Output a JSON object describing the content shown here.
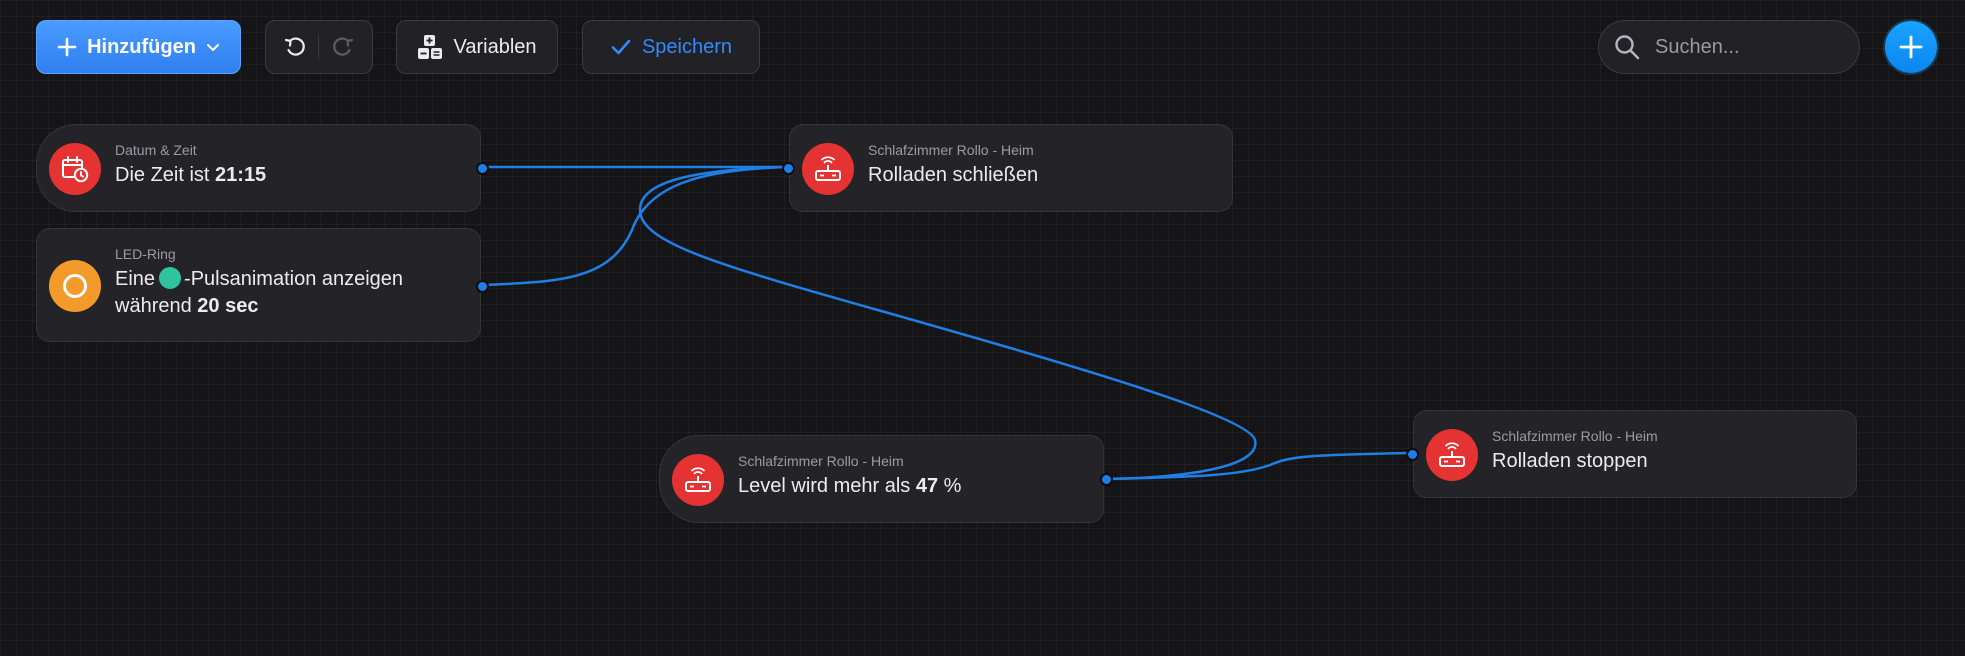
{
  "toolbar": {
    "add_label": "Hinzufügen",
    "variables_label": "Variablen",
    "save_label": "Speichern"
  },
  "search": {
    "placeholder": "Suchen..."
  },
  "nodes": {
    "datetime": {
      "subtitle": "Datum & Zeit",
      "text_prefix": "Die Zeit ist",
      "time_value": "21:15"
    },
    "ledring": {
      "subtitle": "LED-Ring",
      "text_prefix": "Eine",
      "text_suffix": "-Pulsanimation anzeigen",
      "line2_prefix": "während",
      "duration_value": "20 sec",
      "swatch_color": "#2ec4a0"
    },
    "close": {
      "subtitle": "Schlafzimmer Rollo - Heim",
      "text": "Rolladen schließen"
    },
    "level": {
      "subtitle": "Schlafzimmer Rollo - Heim",
      "text_prefix": "Level wird mehr als",
      "level_value": "47",
      "unit": "%"
    },
    "stop": {
      "subtitle": "Schlafzimmer Rollo - Heim",
      "text": "Rolladen stoppen"
    }
  },
  "colors": {
    "accent": "#2f8bff",
    "wire": "#1f7fe6",
    "trigger_red": "#e53232",
    "trigger_orange": "#f39a2a",
    "background": "#151518"
  }
}
